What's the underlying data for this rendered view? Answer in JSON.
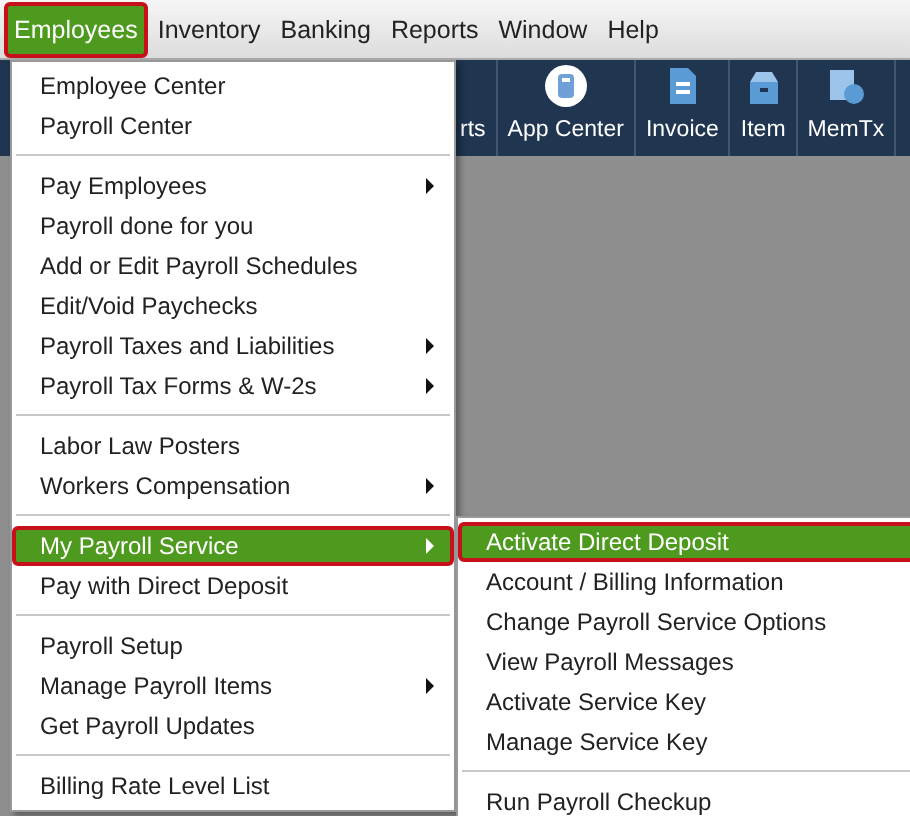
{
  "menubar": [
    {
      "label": "Employees",
      "selected": true
    },
    {
      "label": "Inventory",
      "selected": false
    },
    {
      "label": "Banking",
      "selected": false
    },
    {
      "label": "Reports",
      "selected": false
    },
    {
      "label": "Window",
      "selected": false
    },
    {
      "label": "Help",
      "selected": false
    }
  ],
  "toolbar": [
    {
      "label": "rts"
    },
    {
      "label": "App Center"
    },
    {
      "label": "Invoice"
    },
    {
      "label": "Item"
    },
    {
      "label": "MemTx"
    }
  ],
  "menu": {
    "items": [
      {
        "kind": "item",
        "label": "Employee Center",
        "submenu": false,
        "selected": false
      },
      {
        "kind": "item",
        "label": "Payroll Center",
        "submenu": false,
        "selected": false
      },
      {
        "kind": "separator"
      },
      {
        "kind": "item",
        "label": "Pay Employees",
        "submenu": true,
        "selected": false
      },
      {
        "kind": "item",
        "label": "Payroll done for you",
        "submenu": false,
        "selected": false
      },
      {
        "kind": "item",
        "label": "Add or Edit Payroll Schedules",
        "submenu": false,
        "selected": false
      },
      {
        "kind": "item",
        "label": "Edit/Void Paychecks",
        "submenu": false,
        "selected": false
      },
      {
        "kind": "item",
        "label": "Payroll Taxes and Liabilities",
        "submenu": true,
        "selected": false
      },
      {
        "kind": "item",
        "label": "Payroll Tax Forms & W-2s",
        "submenu": true,
        "selected": false
      },
      {
        "kind": "separator"
      },
      {
        "kind": "item",
        "label": "Labor Law Posters",
        "submenu": false,
        "selected": false
      },
      {
        "kind": "item",
        "label": "Workers Compensation",
        "submenu": true,
        "selected": false
      },
      {
        "kind": "separator"
      },
      {
        "kind": "item",
        "label": "My Payroll Service",
        "submenu": true,
        "selected": true
      },
      {
        "kind": "item",
        "label": "Pay with Direct Deposit",
        "submenu": false,
        "selected": false
      },
      {
        "kind": "separator"
      },
      {
        "kind": "item",
        "label": "Payroll Setup",
        "submenu": false,
        "selected": false
      },
      {
        "kind": "item",
        "label": "Manage Payroll Items",
        "submenu": true,
        "selected": false
      },
      {
        "kind": "item",
        "label": "Get Payroll Updates",
        "submenu": false,
        "selected": false
      },
      {
        "kind": "separator"
      },
      {
        "kind": "item",
        "label": "Billing Rate Level List",
        "submenu": false,
        "selected": false
      }
    ]
  },
  "submenu": {
    "items": [
      {
        "kind": "item",
        "label": "Activate Direct Deposit",
        "submenu": false,
        "selected": true
      },
      {
        "kind": "item",
        "label": "Account / Billing Information",
        "submenu": false,
        "selected": false
      },
      {
        "kind": "item",
        "label": "Change Payroll Service Options",
        "submenu": false,
        "selected": false
      },
      {
        "kind": "item",
        "label": "View Payroll Messages",
        "submenu": false,
        "selected": false
      },
      {
        "kind": "item",
        "label": "Activate Service Key",
        "submenu": false,
        "selected": false
      },
      {
        "kind": "item",
        "label": "Manage Service Key",
        "submenu": false,
        "selected": false
      },
      {
        "kind": "separator"
      },
      {
        "kind": "item",
        "label": "Run Payroll Checkup",
        "submenu": false,
        "selected": false
      }
    ]
  }
}
